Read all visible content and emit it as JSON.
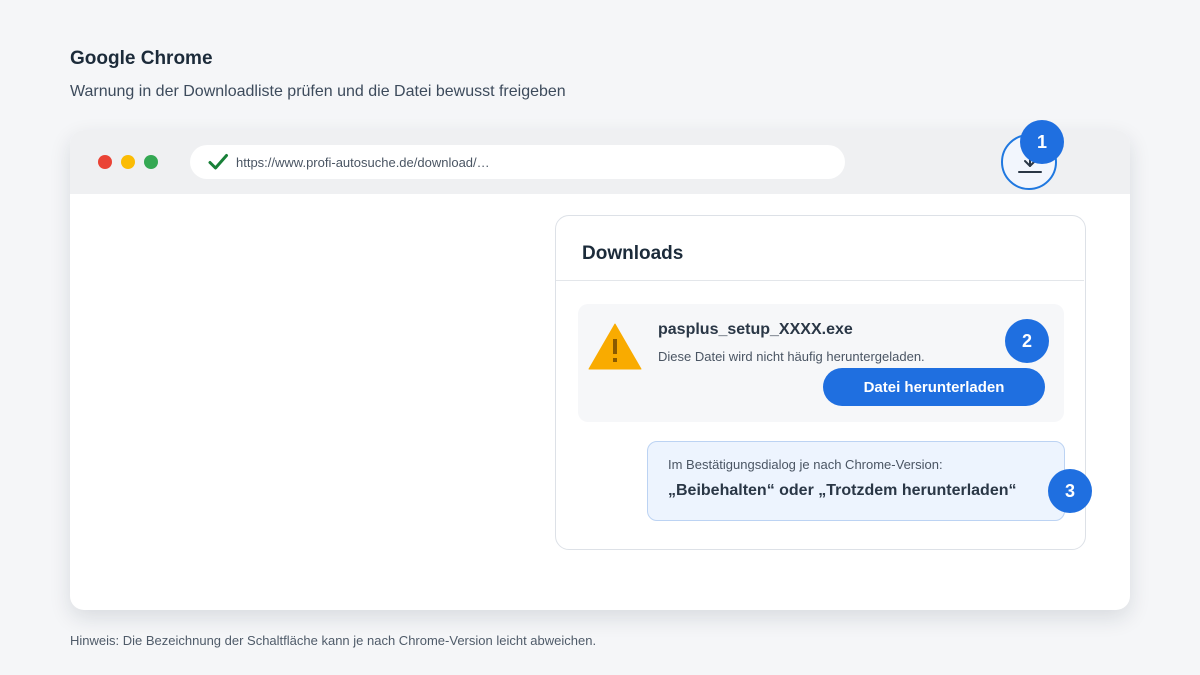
{
  "header": {
    "title": "Google Chrome",
    "subtitle": "Warnung in der Downloadliste prüfen und die Datei bewusst freigeben"
  },
  "browser": {
    "url": "https://www.profi-autosuche.de/download/…",
    "window_controls": [
      "close",
      "minimize",
      "maximize"
    ],
    "download_icon": "download-icon",
    "security_icon": "check-icon"
  },
  "downloads_panel": {
    "title": "Downloads",
    "item": {
      "file_name": "pasplus_setup_XXXX.exe",
      "warning_text": "Diese Datei wird nicht häufig heruntergeladen.",
      "warning_icon": "warning-triangle-icon",
      "button_label": "Datei herunterladen"
    },
    "hint": {
      "line1": "Im Bestätigungsdialog je nach Chrome-Version:",
      "line2": "„Beibehalten“ oder „Trotzdem herunterladen“"
    }
  },
  "steps": {
    "step1": "1",
    "step2": "2",
    "step3": "3"
  },
  "footer": {
    "note": "Hinweis: Die Bezeichnung der Schaltfläche kann je nach Chrome-Version leicht abweichen."
  },
  "colors": {
    "accent": "#1f6fe0",
    "warning": "#f9ab00",
    "check": "#188038",
    "dot_red": "#ea4335",
    "dot_yellow": "#fbbc04",
    "dot_green": "#34a853"
  }
}
